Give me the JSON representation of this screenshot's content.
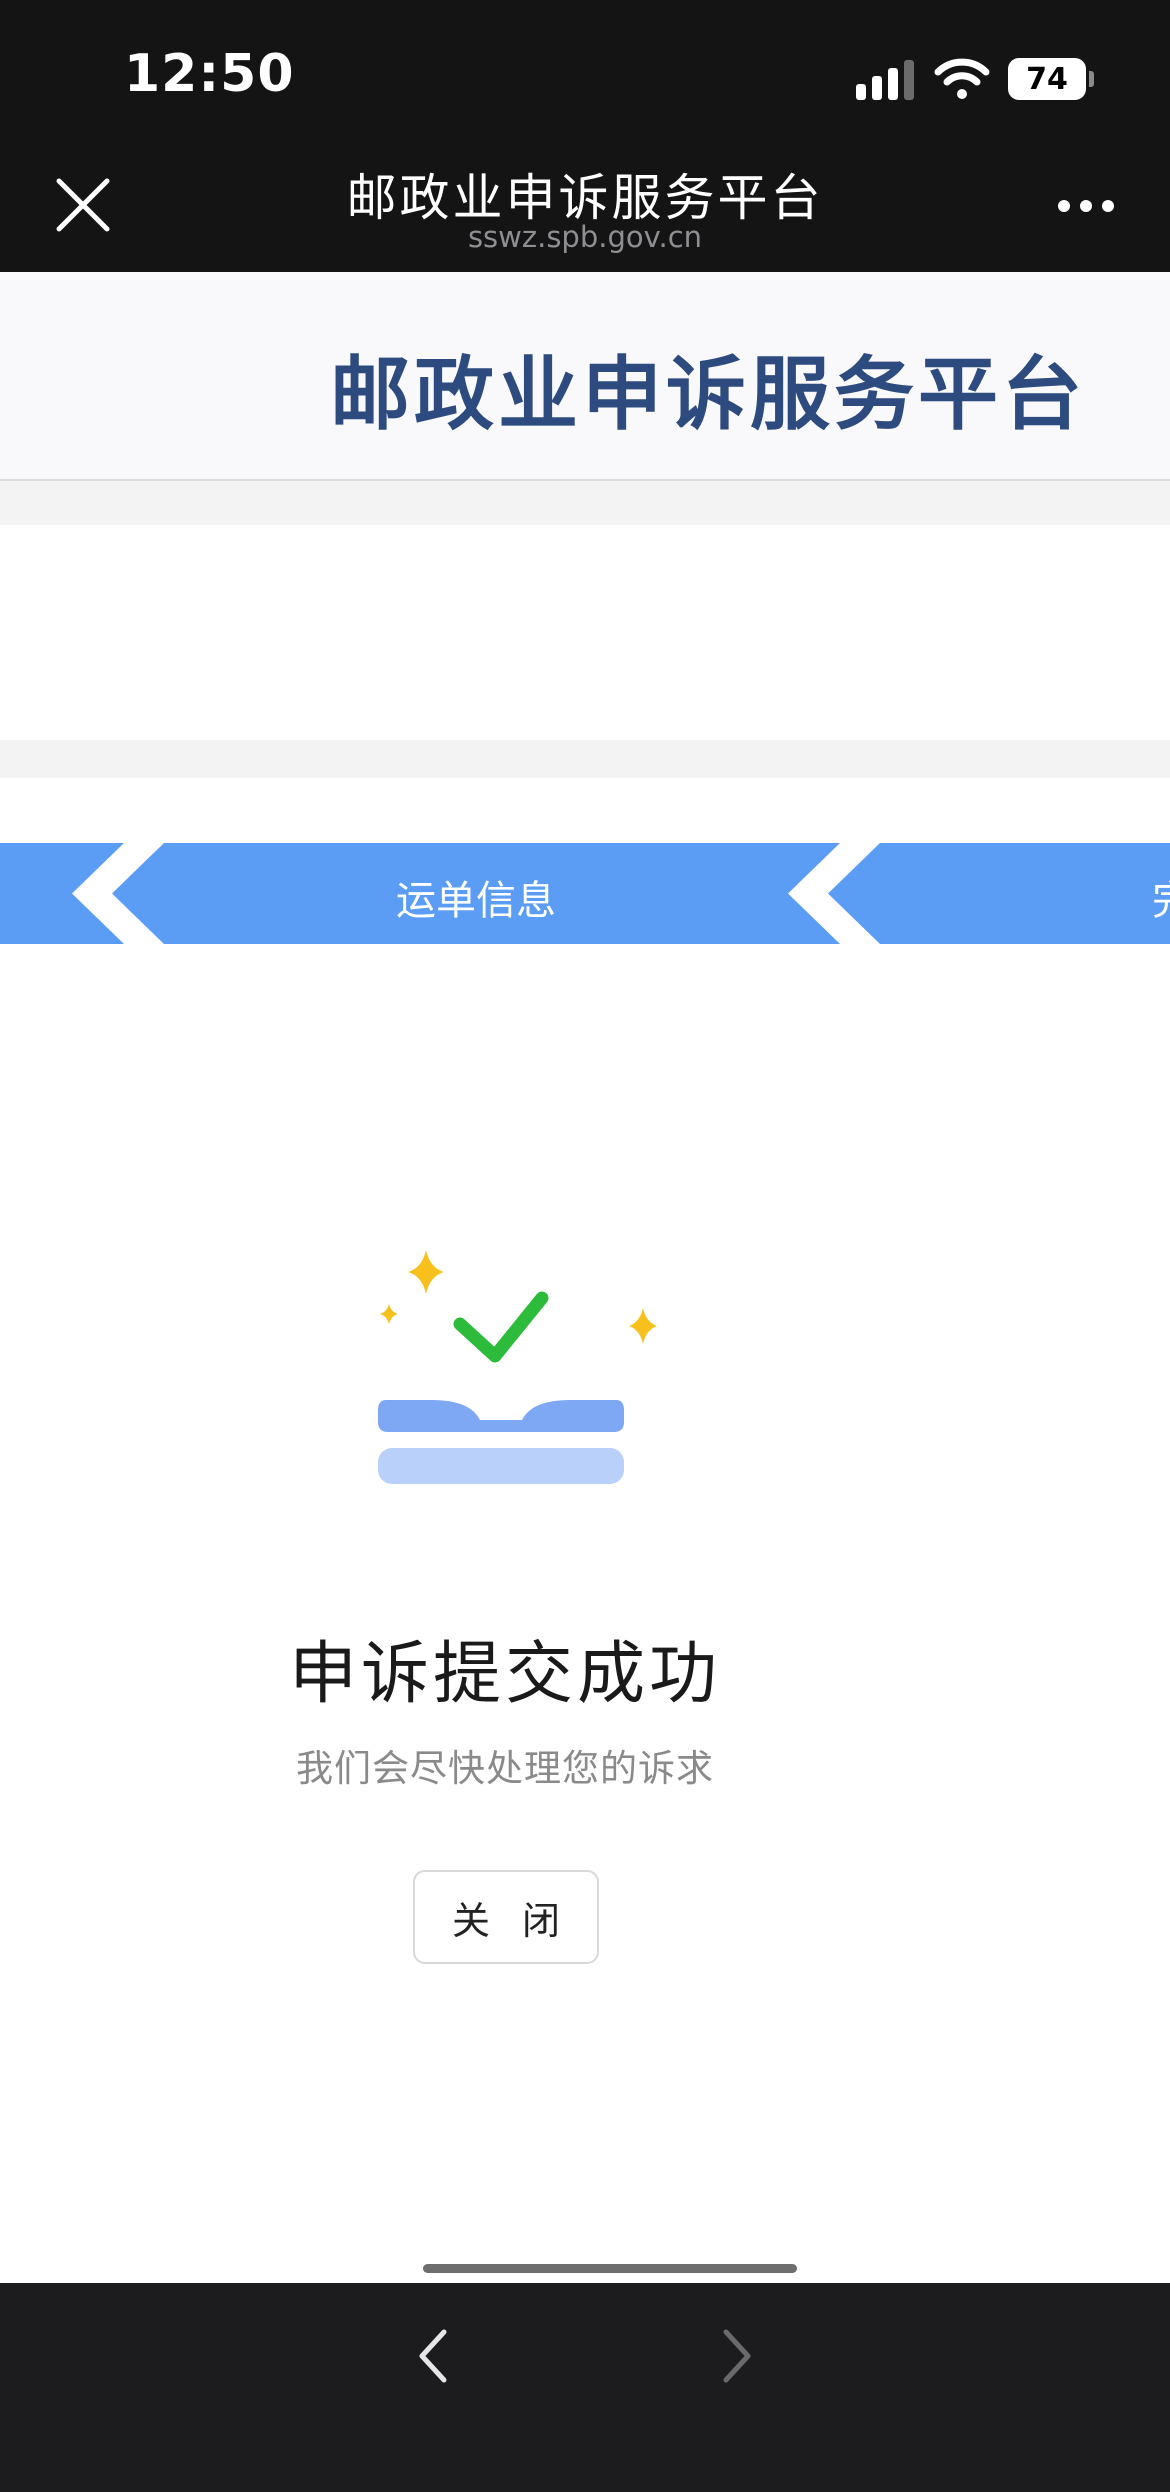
{
  "status_bar": {
    "time": "12:50",
    "battery": "74"
  },
  "browser": {
    "title": "邮政业申诉服务平台",
    "url": "sswz.spb.gov.cn"
  },
  "site": {
    "title": "邮政业申诉服务平台"
  },
  "steps": {
    "items": [
      "运单信息",
      "完"
    ],
    "color": "#5b9cf4"
  },
  "success": {
    "title": "申诉提交成功",
    "subtitle": "我们会尽快处理您的诉求",
    "close_label": "关 闭"
  },
  "icons": {
    "close": "close-icon",
    "more": "more-dots-icon",
    "back": "chevron-left-icon",
    "forward": "chevron-right-icon",
    "success_illustration": "success-check-illustration"
  }
}
